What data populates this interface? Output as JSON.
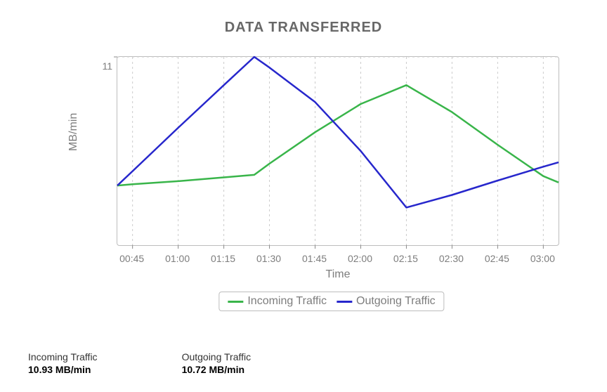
{
  "chart_data": {
    "type": "line",
    "title": "DATA TRANSFERRED",
    "xlabel": "Time",
    "ylabel": "MB/min",
    "categories": [
      "00:40",
      "00:45",
      "01:00",
      "01:15",
      "01:25",
      "01:30",
      "01:45",
      "02:00",
      "02:15",
      "02:30",
      "02:45",
      "03:00",
      "03:05"
    ],
    "x_ticks": [
      "00:45",
      "01:00",
      "01:15",
      "01:30",
      "01:45",
      "02:00",
      "02:15",
      "02:30",
      "02:45",
      "03:00"
    ],
    "y_ticks": [
      11
    ],
    "ylim": [
      8.0,
      11.0
    ],
    "series": [
      {
        "name": "Incoming Traffic",
        "color": "#39B54A",
        "values": [
          8.95,
          8.97,
          9.02,
          9.08,
          9.12,
          9.3,
          9.8,
          10.25,
          10.55,
          10.12,
          9.6,
          9.1,
          9.0
        ]
      },
      {
        "name": "Outgoing Traffic",
        "color": "#2727CC",
        "values": [
          8.95,
          9.18,
          9.87,
          10.55,
          11.0,
          10.83,
          10.28,
          9.5,
          8.6,
          8.8,
          9.03,
          9.25,
          9.32
        ]
      }
    ],
    "legend_position": "bottom"
  },
  "stats": {
    "incoming": {
      "label": "Incoming Traffic",
      "value": "10.93 MB/min"
    },
    "outgoing": {
      "label": "Outgoing Traffic",
      "value": "10.72 MB/min"
    }
  }
}
